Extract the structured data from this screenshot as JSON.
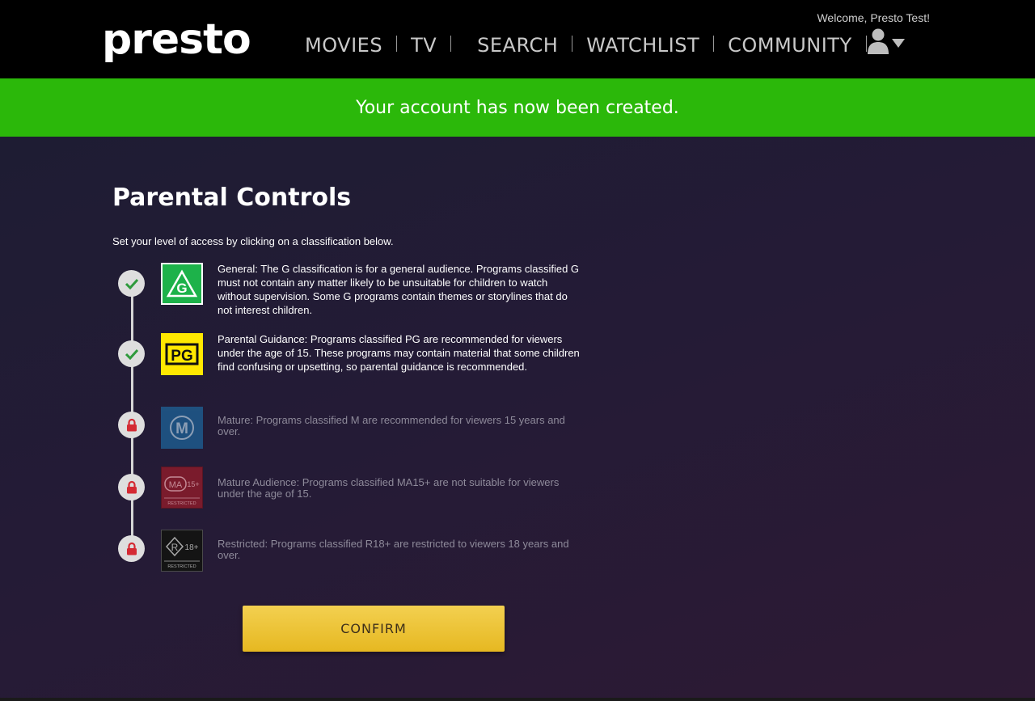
{
  "header": {
    "logo": "presto",
    "nav": [
      "MOVIES",
      "TV",
      "SEARCH",
      "WATCHLIST",
      "COMMUNITY"
    ],
    "welcome": "Welcome, Presto Test!",
    "user_icon": "user-icon",
    "dropdown_icon": "caret-down-icon"
  },
  "banner": {
    "message": "Your account has now been created."
  },
  "main": {
    "title": "Parental Controls",
    "instructions": "Set your level of access by clicking on a classification below.",
    "ratings": [
      {
        "code": "G",
        "status": "allowed",
        "badge_color": "#1db24a",
        "description": "General: The G classification is for a general audience. Programs classified G must not contain any matter likely to be unsuitable for children to watch without supervision. Some G programs contain themes or storylines that do not interest children."
      },
      {
        "code": "PG",
        "status": "allowed",
        "badge_color": "#ffe800",
        "description": "Parental Guidance: Programs classified PG are recommended for viewers under the age of 15. These programs may contain material that some children find confusing or upsetting, so parental guidance is recommended."
      },
      {
        "code": "M",
        "status": "locked",
        "badge_color": "#1e5a8c",
        "description": "Mature: Programs classified M are recommended for viewers 15 years and over."
      },
      {
        "code": "MA",
        "suffix": "15+",
        "sublabel": "RESTRICTED",
        "status": "locked",
        "badge_color": "#7a1b2c",
        "description": "Mature Audience: Programs classified MA15+ are not suitable for viewers under the age of 15."
      },
      {
        "code": "R",
        "suffix": "18+",
        "sublabel": "RESTRICTED",
        "status": "locked",
        "badge_color": "#141414",
        "description": "Restricted: Programs classified R18+ are restricted to viewers 18 years and over."
      }
    ],
    "confirm_label": "CONFIRM"
  },
  "colors": {
    "banner_green": "#2bb80a",
    "check_green": "#2e9a3c",
    "lock_red": "#d42a33",
    "confirm_yellow": "#eec232"
  }
}
